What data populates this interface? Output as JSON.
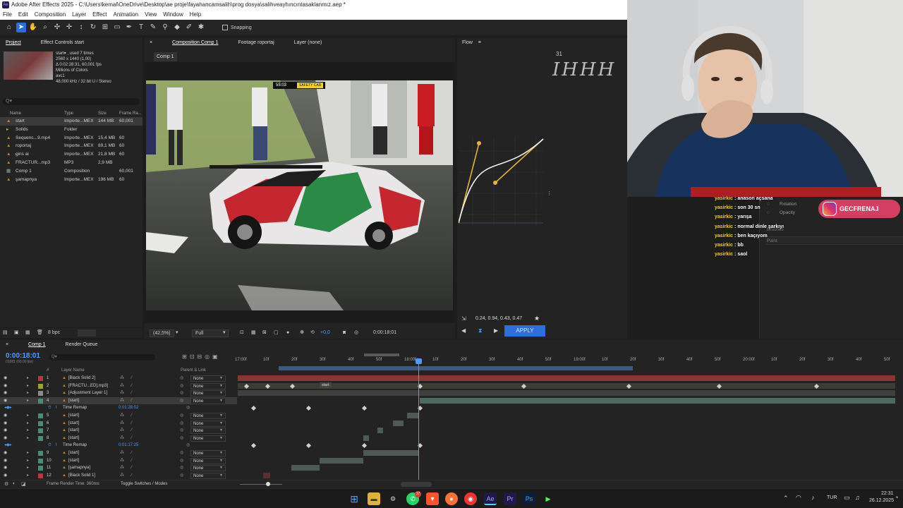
{
  "app": {
    "title": "Adobe After Effects 2025 - C:\\Users\\kemal\\OneDrive\\Desktop\\ae proje\\fayahancamsalih\\prog dosya\\salihveayhıncıntasaklanmız.aep *",
    "menus": [
      "File",
      "Edit",
      "Composition",
      "Layer",
      "Effect",
      "Animation",
      "View",
      "Window",
      "Help"
    ],
    "snapping_label": "Snapping"
  },
  "project": {
    "tabs": [
      "Project",
      "Effect Controls start"
    ],
    "item_info": [
      "start▾ , used 7 times",
      "2560 x 1440 (1,00)",
      "Δ 0:02:28:31, 60,001 fps",
      "Millions of Colors",
      "avc1",
      "48,000 kHz / 32 bit U / Stereo"
    ],
    "search_placeholder": "Q▾",
    "columns": [
      "Name",
      "Type",
      "Size",
      "Frame Ra..."
    ],
    "items": [
      {
        "name": "start",
        "type": "Importe...MEX",
        "size": "144 MB",
        "fr": "60,001",
        "color": "#c8841f"
      },
      {
        "name": "Solids",
        "type": "Folder",
        "size": "",
        "fr": "",
        "color": "#cfb13a"
      },
      {
        "name": "Sequenc...9.mp4",
        "type": "Importe...MEX",
        "size": "15,4 MB",
        "fr": "60",
        "color": "#c8841f"
      },
      {
        "name": "roportaj",
        "type": "Importe...MEX",
        "size": "89,1 MB",
        "fr": "60",
        "color": "#c8841f"
      },
      {
        "name": "gins ai",
        "type": "Importe...MEX",
        "size": "21,8 MB",
        "fr": "60",
        "color": "#c8841f"
      },
      {
        "name": "FRACTUR...mp3",
        "type": "MP3",
        "size": "2,9 MB",
        "fr": "",
        "color": "#c8841f"
      },
      {
        "name": "Comp 1",
        "type": "Composition",
        "size": "",
        "fr": "60,001",
        "color": "#9aa4b0"
      },
      {
        "name": "şamapnya",
        "type": "Importe...MEX",
        "size": "196 MB",
        "fr": "60",
        "color": "#c8841f"
      }
    ],
    "bpc": "8 bpc"
  },
  "composition": {
    "tabs": [
      "Composition Comp 1",
      "Footage roportaj",
      "Layer (none)"
    ],
    "subtab": "Comp 1",
    "zoom": "(42,5%)",
    "resolution": "Full",
    "exposure": "+0,0",
    "timecode": "0:00:18:01",
    "overlay_time": "55:03",
    "overlay_badge": "SAFETY CAR"
  },
  "flow": {
    "title": "Flow",
    "values": "0.24, 0.94, 0.43, 0.47",
    "apply": "APPLY",
    "top_number": "31"
  },
  "overlay": {
    "chat": [
      {
        "user": "yasirkic",
        "msg": "anason açsana"
      },
      {
        "user": "yasirkic",
        "msg": "son 30 sn"
      },
      {
        "user": "yasirkic",
        "msg": "yarışa"
      },
      {
        "user": "yasirkic",
        "msg": "normal dinle şarkıyı"
      },
      {
        "user": "yasirkic",
        "msg": "ben kaçıyom"
      },
      {
        "user": "yasirkic",
        "msg": "bb"
      },
      {
        "user": "yasirkic",
        "msg": "saol"
      }
    ],
    "instagram": "GECFRENAJ",
    "panel_items": [
      "Rotation",
      "Opacity",
      "Brushes",
      "Paint"
    ]
  },
  "timeline": {
    "tabs": [
      "Comp 1",
      "Render Queue"
    ],
    "timecode": "0:00:18:01",
    "timecode_sub": "01081 (60.00 fps)",
    "col_headers": [
      "#",
      "Layer Name",
      "Parent & Link"
    ],
    "ruler": [
      "17:00f",
      "10f",
      "20f",
      "30f",
      "40f",
      "50f",
      "18:00f",
      "10f",
      "20f",
      "30f",
      "40f",
      "50f",
      "19:00f",
      "10f",
      "20f",
      "30f",
      "40f",
      "50f",
      "20:00f",
      "10f",
      "20f",
      "30f",
      "40f",
      "50f"
    ],
    "layers": [
      {
        "num": "1",
        "name": "[Black Solid 2]",
        "parent": "None",
        "color": "#b33a3a"
      },
      {
        "num": "2",
        "name": "[FRACTU...ED].mp3]",
        "parent": "None",
        "color": "#9ca03a"
      },
      {
        "num": "3",
        "name": "[Adjustment Layer 1]",
        "parent": "None",
        "color": "#8a8a8a"
      },
      {
        "num": "4",
        "name": "[start]",
        "parent": "None",
        "color": "#4a8a78",
        "sel": true
      },
      {
        "num": "",
        "name": "Time Remap",
        "parent": "",
        "value": "0:01:28:02",
        "prop": true
      },
      {
        "num": "5",
        "name": "[start]",
        "parent": "None",
        "color": "#4a8a78"
      },
      {
        "num": "6",
        "name": "[start]",
        "parent": "None",
        "color": "#4a8a78"
      },
      {
        "num": "7",
        "name": "[start]",
        "parent": "None",
        "color": "#4a8a78"
      },
      {
        "num": "8",
        "name": "[start]",
        "parent": "None",
        "color": "#4a8a78"
      },
      {
        "num": "",
        "name": "Time Remap",
        "parent": "",
        "value": "0:01:17:25",
        "prop": true
      },
      {
        "num": "9",
        "name": "[start]",
        "parent": "None",
        "color": "#4a8a78"
      },
      {
        "num": "10",
        "name": "[start]",
        "parent": "None",
        "color": "#4a8a78"
      },
      {
        "num": "11",
        "name": "[şamapnya]",
        "parent": "None",
        "color": "#4a8a78"
      },
      {
        "num": "12",
        "name": "[Black Solid 1]",
        "parent": "None",
        "color": "#b33a3a"
      }
    ],
    "footer_left": "Frame Render Time: 360ms",
    "footer_mid": "Toggle Switches / Modes",
    "marker_label": "start"
  },
  "taskbar": {
    "lang": "TUR",
    "time": "22:31",
    "date": "26.12.2025",
    "badge": "17"
  }
}
